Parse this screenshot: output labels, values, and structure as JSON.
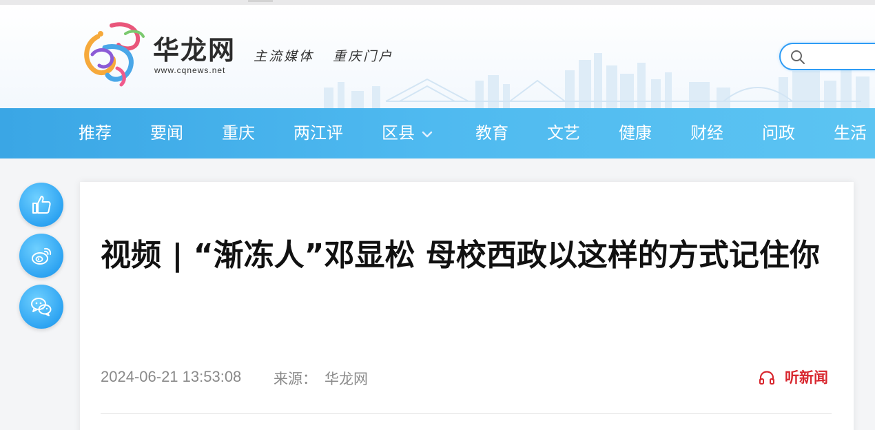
{
  "header": {
    "brand_name": "华龙网",
    "brand_url": "www.cqnews.net",
    "slogan": "主流媒体   重庆门户",
    "search": {
      "placeholder": ""
    }
  },
  "nav": {
    "items": [
      {
        "label": "推荐"
      },
      {
        "label": "要闻"
      },
      {
        "label": "重庆"
      },
      {
        "label": "两江评"
      },
      {
        "label": "区县",
        "has_dropdown": true
      },
      {
        "label": "教育"
      },
      {
        "label": "文艺"
      },
      {
        "label": "健康"
      },
      {
        "label": "财经"
      },
      {
        "label": "问政"
      },
      {
        "label": "生活"
      }
    ]
  },
  "side_actions": [
    {
      "icon": "thumbs-up-icon"
    },
    {
      "icon": "weibo-icon"
    },
    {
      "icon": "wechat-icon"
    }
  ],
  "article": {
    "title": "视频 | “渐冻人”邓显松 母校西政以这样的方式记住你",
    "date": "2024-06-21 13:53:08",
    "source_label": "来源：",
    "source": "华龙网",
    "listen_label": "听新闻"
  },
  "colors": {
    "nav_bg": "#4fbaf0",
    "accent_red": "#d8262e",
    "search_border": "#2e9cf5"
  }
}
